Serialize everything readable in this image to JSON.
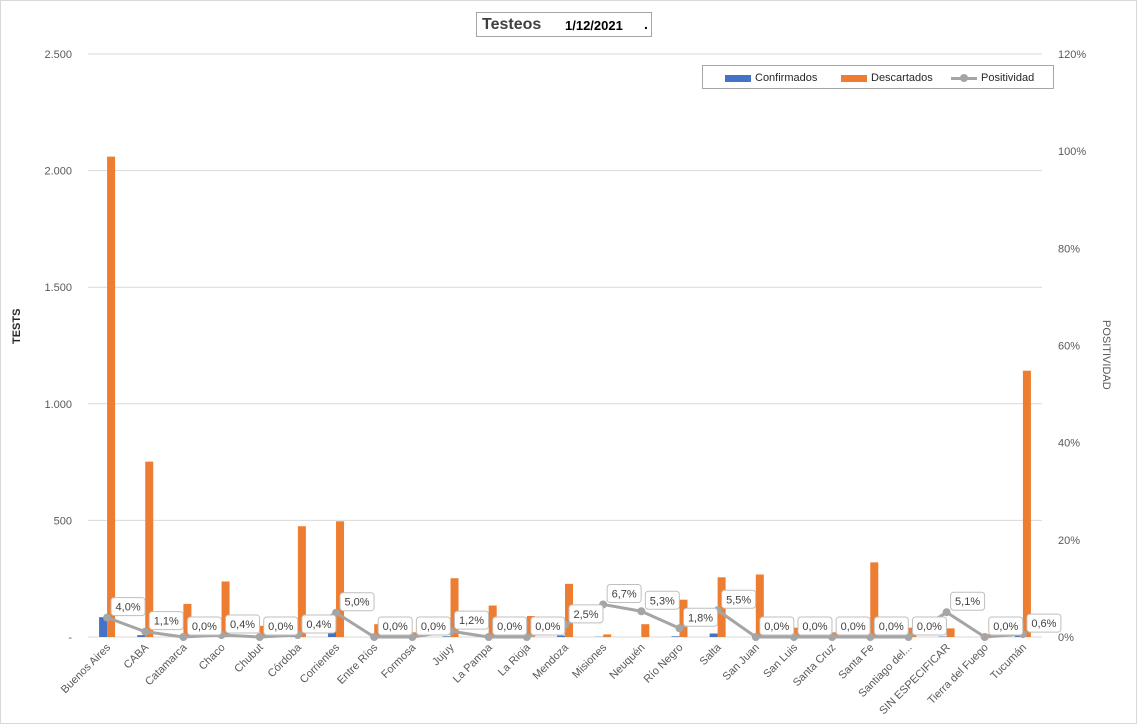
{
  "chart_data": {
    "type": "bar",
    "title": "Testeos",
    "subtitle": "1/12/2021",
    "title_suffix": ".",
    "ylabel": "TESTS",
    "y2label": "POSITIVIDAD",
    "ylim": [
      0,
      2500
    ],
    "y2lim": [
      0,
      120
    ],
    "yticks": [
      "-",
      "500",
      "1.000",
      "1.500",
      "2.000",
      "2.500"
    ],
    "y2ticks": [
      "0%",
      "20%",
      "40%",
      "60%",
      "80%",
      "100%",
      "120%"
    ],
    "grid": true,
    "legend_position": "top-right",
    "categories": [
      "Buenos Aires",
      "CABA",
      "Catamarca",
      "Chaco",
      "Chubut",
      "Córdoba",
      "Corrientes",
      "Entre Ríos",
      "Formosa",
      "Jujuy",
      "La Pampa",
      "La Rioja",
      "Mendoza",
      "Misiones",
      "Neuquén",
      "Río Negro",
      "Salta",
      "San Juan",
      "San Luis",
      "Santa Cruz",
      "Santa Fe",
      "Santiago del...",
      "SIN ESPECIFICAR",
      "Tierra del Fuego",
      "Tucumán"
    ],
    "series": [
      {
        "name": "Confirmados",
        "kind": "bar",
        "color": "#4472c4",
        "values": [
          85,
          8,
          0,
          1,
          0,
          2,
          26,
          0,
          0,
          3,
          0,
          0,
          6,
          1,
          0,
          3,
          15,
          0,
          0,
          0,
          0,
          0,
          2,
          0,
          7
        ]
      },
      {
        "name": "Descartados",
        "kind": "bar",
        "color": "#ed7d31",
        "values": [
          2060,
          752,
          142,
          238,
          48,
          475,
          496,
          55,
          20,
          252,
          135,
          90,
          228,
          11,
          55,
          160,
          256,
          268,
          40,
          20,
          320,
          40,
          37,
          12,
          1142
        ]
      },
      {
        "name": "Positividad",
        "kind": "line",
        "axis": "right",
        "color": "#a5a5a5",
        "values": [
          4.0,
          1.1,
          0.0,
          0.4,
          0.0,
          0.4,
          5.0,
          0.0,
          0.0,
          1.2,
          0.0,
          0.0,
          2.5,
          6.7,
          5.3,
          1.8,
          5.5,
          0.0,
          0.0,
          0.0,
          0.0,
          0.0,
          5.1,
          0.0,
          0.6
        ],
        "labels": [
          "4,0%",
          "1,1%",
          "0,0%",
          "0,4%",
          "0,0%",
          "0,4%",
          "5,0%",
          "0,0%",
          "0,0%",
          "1,2%",
          "0,0%",
          "0,0%",
          "2,5%",
          "6,7%",
          "5,3%",
          "1,8%",
          "5,5%",
          "0,0%",
          "0,0%",
          "0,0%",
          "0,0%",
          "0,0%",
          "5,1%",
          "0,0%",
          "0,6%"
        ]
      }
    ]
  }
}
